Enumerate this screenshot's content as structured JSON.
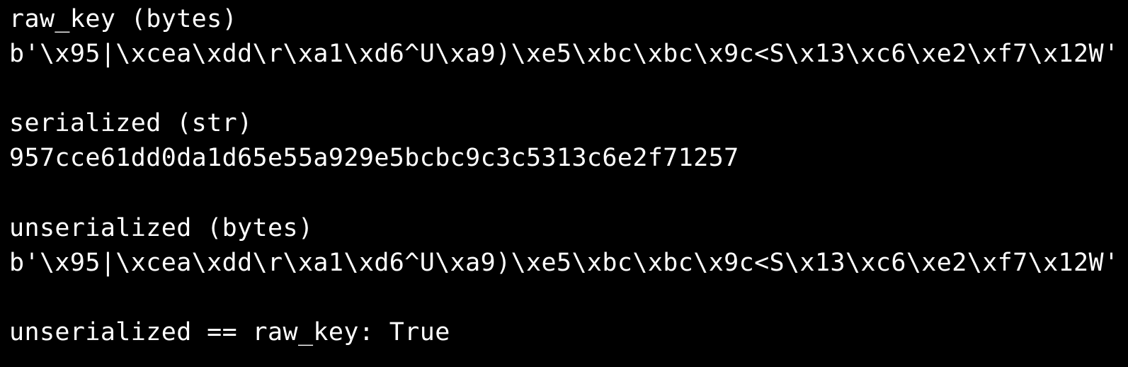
{
  "terminal": {
    "lines": [
      "raw_key (bytes)",
      "b'\\x95|\\xcea\\xdd\\r\\xa1\\xd6^U\\xa9)\\xe5\\xbc\\xbc\\x9c<S\\x13\\xc6\\xe2\\xf7\\x12W'",
      "serialized (str)",
      "957cce61dd0da1d65e55a929e5bcbc9c3c5313c6e2f71257",
      "unserialized (bytes)",
      "b'\\x95|\\xcea\\xdd\\r\\xa1\\xd6^U\\xa9)\\xe5\\xbc\\xbc\\x9c<S\\x13\\xc6\\xe2\\xf7\\x12W'",
      "unserialized == raw_key: True"
    ],
    "colors": {
      "background": "#000000",
      "foreground": "#ffffff"
    }
  }
}
